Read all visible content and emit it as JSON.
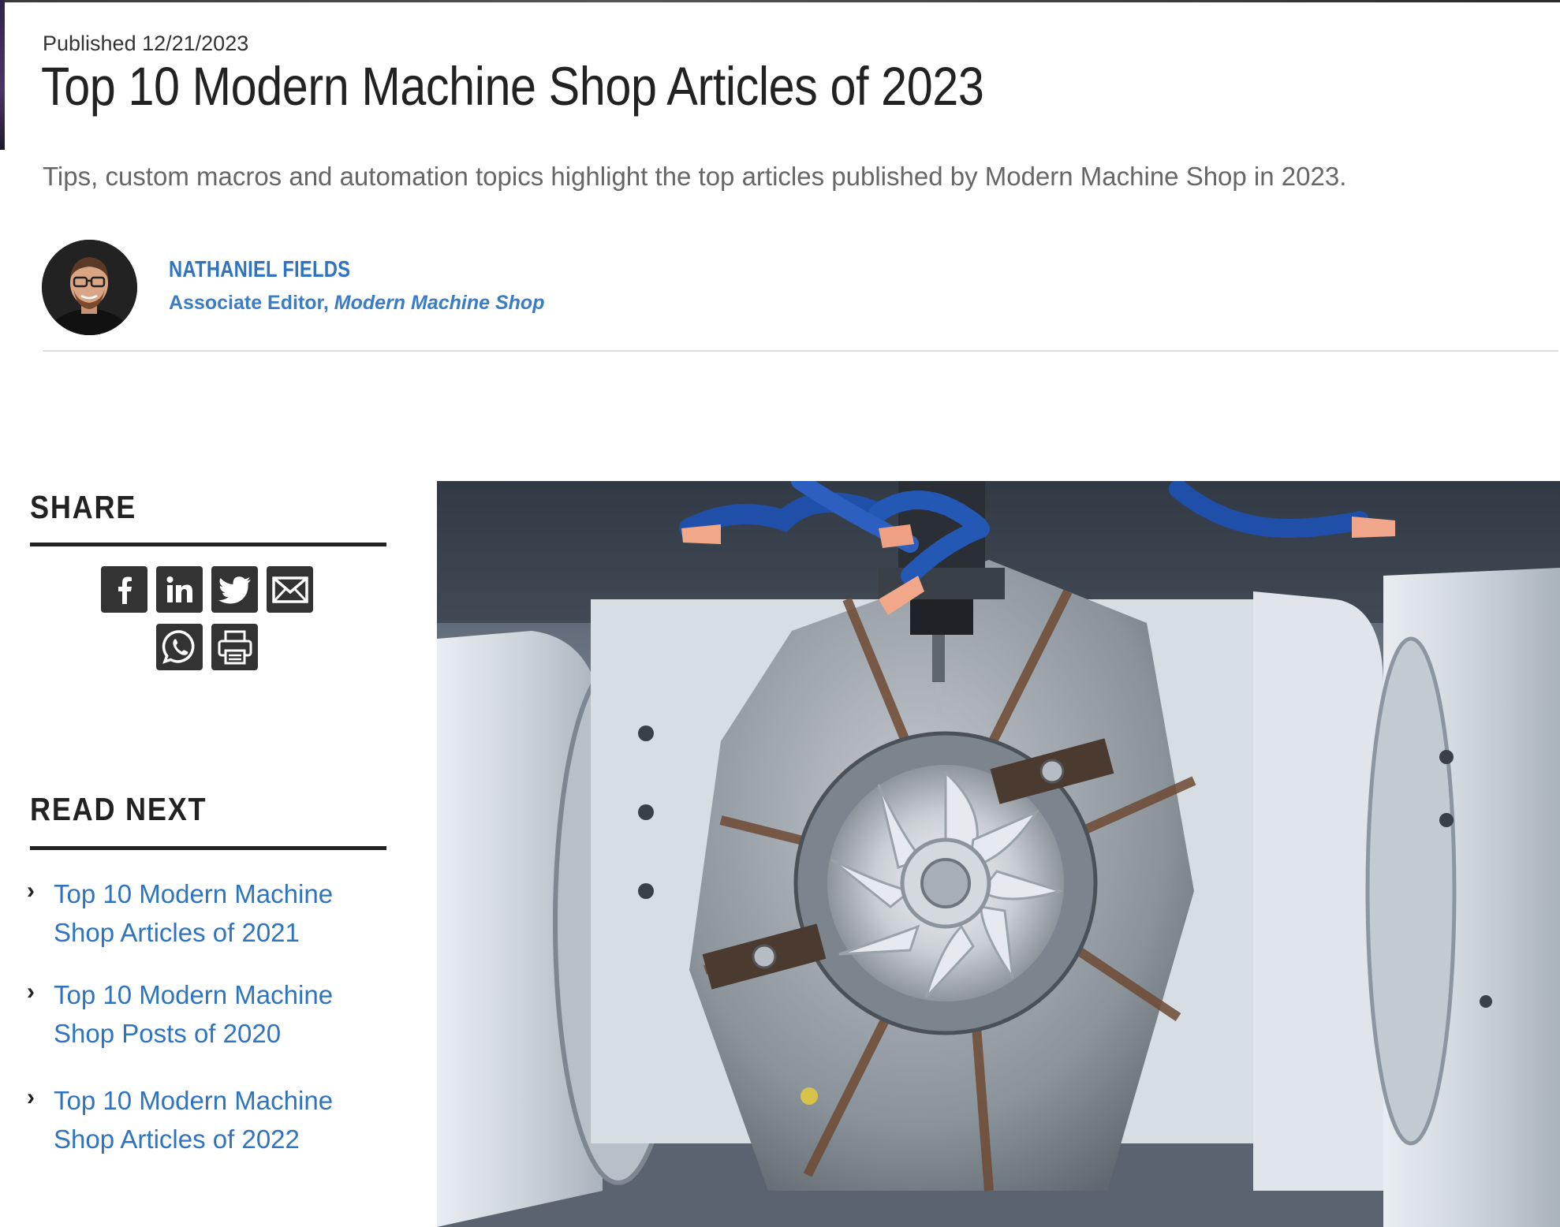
{
  "article": {
    "published": "Published 12/21/2023",
    "title": "Top 10 Modern Machine Shop Articles of 2023",
    "subtitle": "Tips, custom macros and automation topics highlight the top articles published by Modern Machine Shop in 2023."
  },
  "author": {
    "name": "NATHANIEL FIELDS",
    "role_prefix": "Associate Editor, ",
    "publication": "Modern Machine Shop"
  },
  "share": {
    "heading": "SHARE",
    "buttons": [
      {
        "icon": "facebook-icon"
      },
      {
        "icon": "linkedin-icon"
      },
      {
        "icon": "twitter-icon"
      },
      {
        "icon": "email-icon"
      },
      {
        "icon": "whatsapp-icon"
      },
      {
        "icon": "print-icon"
      }
    ]
  },
  "read_next": {
    "heading": "READ NEXT",
    "items": [
      {
        "label": "Top 10 Modern Machine Shop Articles of 2021"
      },
      {
        "label": "Top 10 Modern Machine Shop Posts of 2020"
      },
      {
        "label": "Top 10 Modern Machine Shop Articles of 2022"
      }
    ]
  },
  "colors": {
    "link": "#2f74c0",
    "heading": "#222222",
    "share_button": "#333333"
  }
}
